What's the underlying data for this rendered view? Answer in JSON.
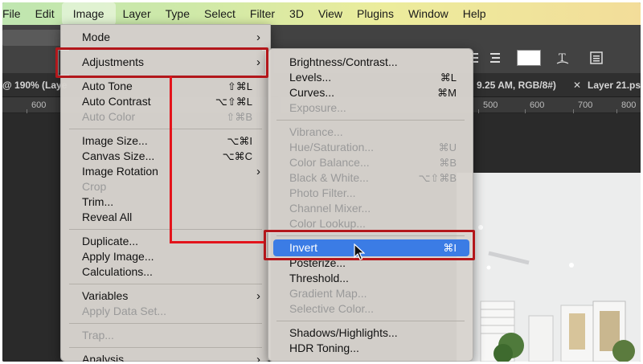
{
  "menubar": {
    "items": [
      "File",
      "Edit",
      "Image",
      "Layer",
      "Type",
      "Select",
      "Filter",
      "3D",
      "View",
      "Plugins",
      "Window",
      "Help"
    ]
  },
  "tabs": {
    "left": "@ 190% (Laye",
    "middle": "9.25 AM, RGB/8#)",
    "right": "Layer 21.ps"
  },
  "ruler": [
    "600",
    "500",
    "600",
    "700",
    "800"
  ],
  "image_menu": {
    "mode": "Mode",
    "adjustments": "Adjustments",
    "auto_tone": "Auto Tone",
    "auto_tone_sc": "⇧⌘L",
    "auto_contrast": "Auto Contrast",
    "auto_contrast_sc": "⌥⇧⌘L",
    "auto_color": "Auto Color",
    "auto_color_sc": "⇧⌘B",
    "image_size": "Image Size...",
    "image_size_sc": "⌥⌘I",
    "canvas_size": "Canvas Size...",
    "canvas_size_sc": "⌥⌘C",
    "image_rotation": "Image Rotation",
    "crop": "Crop",
    "trim": "Trim...",
    "reveal_all": "Reveal All",
    "duplicate": "Duplicate...",
    "apply_image": "Apply Image...",
    "calculations": "Calculations...",
    "variables": "Variables",
    "apply_data_set": "Apply Data Set...",
    "trap": "Trap...",
    "analysis": "Analysis",
    "submenu_arrow": "›"
  },
  "adjust_menu": {
    "brightness": "Brightness/Contrast...",
    "levels": "Levels...",
    "levels_sc": "⌘L",
    "curves": "Curves...",
    "curves_sc": "⌘M",
    "exposure": "Exposure...",
    "vibrance": "Vibrance...",
    "hue": "Hue/Saturation...",
    "hue_sc": "⌘U",
    "color_balance": "Color Balance...",
    "color_balance_sc": "⌘B",
    "bw": "Black & White...",
    "bw_sc": "⌥⇧⌘B",
    "photo_filter": "Photo Filter...",
    "channel_mixer": "Channel Mixer...",
    "color_lookup": "Color Lookup...",
    "invert": "Invert",
    "invert_sc": "⌘I",
    "posterize": "Posterize...",
    "threshold": "Threshold...",
    "gradient_map": "Gradient Map...",
    "selective_color": "Selective Color...",
    "shadows": "Shadows/Highlights...",
    "hdr": "HDR Toning..."
  },
  "colors": {
    "highlight": "#3b7ce5",
    "annotation": "#b3171b"
  }
}
